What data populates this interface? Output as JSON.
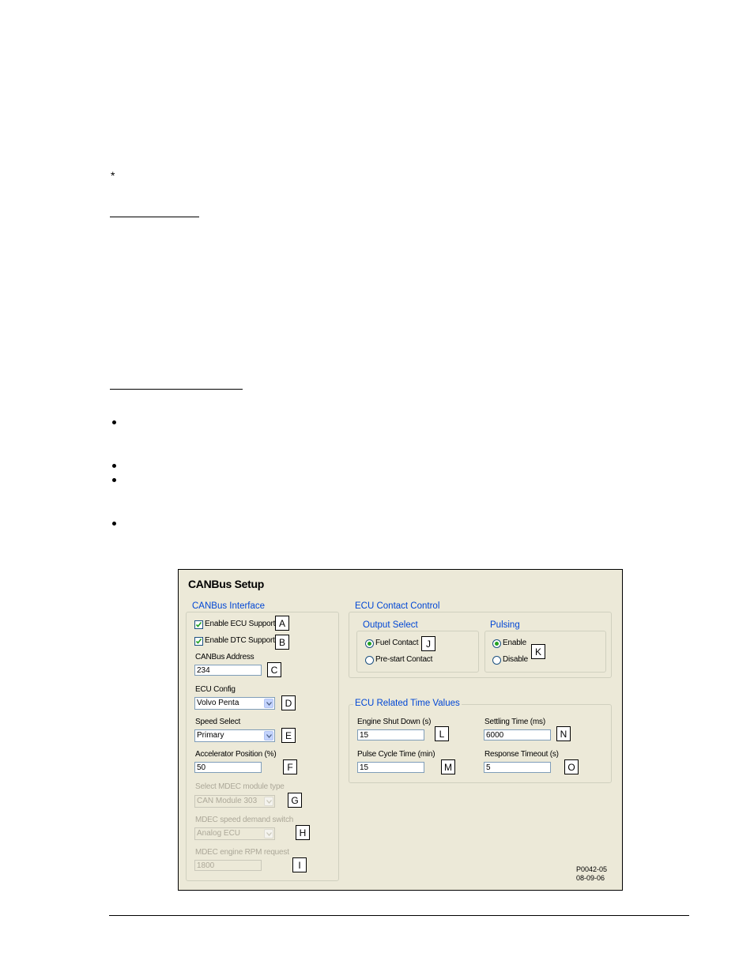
{
  "page": {
    "footnote_marker": "*"
  },
  "dialog": {
    "title": "CANBus Setup",
    "canbus_interface": {
      "legend": "CANBus Interface",
      "enable_ecu_support": {
        "label": "Enable ECU Support",
        "checked": true
      },
      "enable_dtc_support": {
        "label": "Enable DTC Support",
        "checked": true
      },
      "canbus_address": {
        "label": "CANBus Address",
        "value": "234"
      },
      "ecu_config": {
        "label": "ECU Config",
        "value": "Volvo Penta"
      },
      "speed_select": {
        "label": "Speed Select",
        "value": "Primary"
      },
      "accelerator_position": {
        "label": "Accelerator Position (%)",
        "value": "50"
      },
      "mdec_module_type": {
        "label": "Select MDEC module type",
        "value": "CAN Module 303"
      },
      "mdec_speed_demand": {
        "label": "MDEC speed demand switch",
        "value": "Analog ECU"
      },
      "mdec_rpm_request": {
        "label": "MDEC engine RPM request",
        "value": "1800"
      }
    },
    "ecu_contact_control": {
      "legend": "ECU Contact Control",
      "output_select": {
        "legend": "Output Select",
        "fuel_contact": "Fuel Contact",
        "prestart_contact": "Pre-start Contact",
        "selected": "Fuel Contact"
      },
      "pulsing": {
        "legend": "Pulsing",
        "enable": "Enable",
        "disable": "Disable",
        "selected": "Enable"
      }
    },
    "ecu_time_values": {
      "legend": "ECU Related Time Values",
      "engine_shut_down": {
        "label": "Engine Shut Down (s)",
        "value": "15"
      },
      "settling_time": {
        "label": "Settling Time (ms)",
        "value": "6000"
      },
      "pulse_cycle_time": {
        "label": "Pulse Cycle Time (min)",
        "value": "15"
      },
      "response_timeout": {
        "label": "Response Timeout (s)",
        "value": "5"
      }
    },
    "callouts": {
      "a": "A",
      "b": "B",
      "c": "C",
      "d": "D",
      "e": "E",
      "f": "F",
      "g": "G",
      "h": "H",
      "i": "I",
      "j": "J",
      "k": "K",
      "l": "L",
      "m": "M",
      "n": "N",
      "o": "O"
    },
    "figure_id": "P0042-05",
    "figure_date": "08-09-06"
  }
}
